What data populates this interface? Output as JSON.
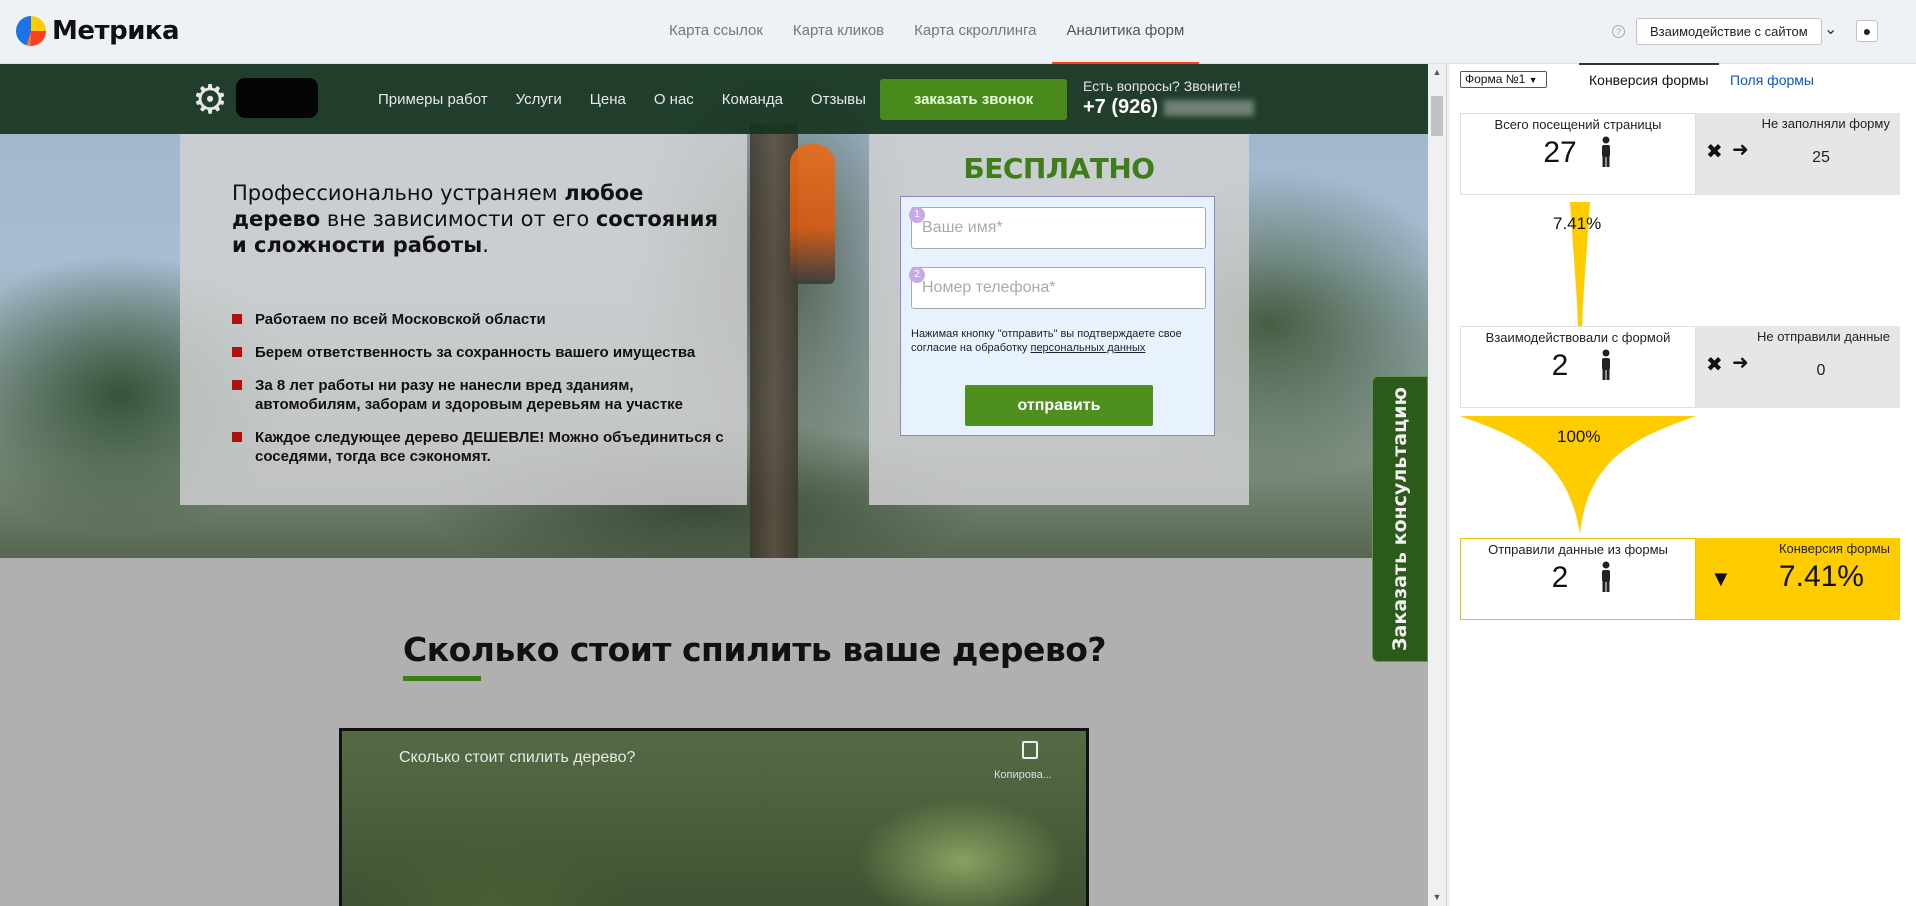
{
  "app": {
    "name": "Метрика"
  },
  "top_tabs": [
    {
      "label": "Карта ссылок"
    },
    {
      "label": "Карта кликов"
    },
    {
      "label": "Карта скроллинга"
    },
    {
      "label": "Аналитика форм"
    }
  ],
  "header": {
    "mode_button": "Взаимодействие с сайтом",
    "help": "?"
  },
  "site": {
    "nav_links": [
      "Примеры работ",
      "Услуги",
      "Цена",
      "О нас",
      "Команда",
      "Отзывы"
    ],
    "call_button": "заказать звонок",
    "question": "Есть вопросы? Звоните!",
    "phone": "+7 (926)",
    "hero_heading_1": "Профессионально устраняем ",
    "hero_heading_b1": "любое дерево",
    "hero_heading_2": " вне зависимости от его ",
    "hero_heading_b2": "состояния и сложности работы",
    "hero_heading_3": ".",
    "bullets": [
      "Работаем по всей Московской области",
      "Берем ответственность за сохранность вашего имущества",
      "За 8 лет работы ни разу не нанесли вред зданиям, автомобилям, заборам и здоровым деревьям на участке",
      "Каждое следующее дерево ДЕШЕВЛЕ! Можно объединиться с соседями, тогда все сэкономят."
    ],
    "form_title": "БЕСПЛАТНО",
    "field_name_placeholder": "Ваше имя*",
    "field_phone_placeholder": "Номер телефона*",
    "field_1_num": "1",
    "field_2_num": "2",
    "consent_text": "Нажимая кнопку \"отправить\" вы подтверждаете свое согласие на обработку ",
    "consent_link": "персональных данных",
    "send_button": "отправить",
    "side_tab": "Заказать консультацию",
    "section_title": "Сколько стоит спилить ваше дерево?",
    "video_title": "Сколько стоит спилить дерево?",
    "video_copy": "Копирова..."
  },
  "panel": {
    "form_select": "Форма №1",
    "tab_conversion": "Конверсия формы",
    "tab_fields": "Поля формы",
    "visits_label": "Всего посещений страницы",
    "visits_value": "27",
    "not_filled_label": "Не заполняли форму",
    "not_filled_value": "25",
    "rate_1": "7.41%",
    "interacted_label": "Взаимодействовали с формой",
    "interacted_value": "2",
    "not_sent_label": "Не отправили данные",
    "not_sent_value": "0",
    "rate_2": "100%",
    "sent_label": "Отправили данные из формы",
    "sent_value": "2",
    "conversion_label": "Конверсия формы",
    "conversion_value": "7.41%"
  },
  "colors": {
    "brand_red": "#fc3f1d",
    "conversion_yellow": "#ffcc00",
    "site_green": "#3e7d1a"
  }
}
